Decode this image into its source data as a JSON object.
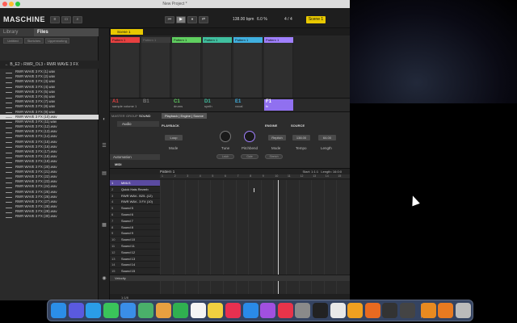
{
  "window": {
    "title": "New Project *"
  },
  "header": {
    "logo": "MASCHINE",
    "tempo": "138.00",
    "tempo_unit": "bpm",
    "cpu": "6.0 %",
    "time_sig": "4 / 4",
    "scene": "Scene 1"
  },
  "browser": {
    "tab_library": "Library",
    "tab_files": "Files",
    "subtabs": [
      "Untitled",
      "Sketches",
      "Upperworkng"
    ],
    "path": "← B_E2 › RWR_OL3 › RWR WAVE 3 FX",
    "files": [
      "RWR WAVE 3 FX (1).wav",
      "RWR WAVE 3 FX (2).wav",
      "RWR WAVE 3 FX (3).wav",
      "RWR WAVE 3 FX (4).wav",
      "RWR WAVE 3 FX (5).wav",
      "RWR WAVE 3 FX (6).wav",
      "RWR WAVE 3 FX (7).wav",
      "RWR WAVE 3 FX (8).wav",
      "RWR WAVE 3 FX (9).wav",
      "RWR WAVE 3 FX (10).wav",
      "RWR WAVE 3 FX (11).wav",
      "RWR WAVE 3 FX (12).wav",
      "RWR WAVE 3 FX (13).wav",
      "RWR WAVE 3 FX (14).wav",
      "RWR WAVE 3 FX (15).wav",
      "RWR WAVE 3 FX (16).wav",
      "RWR WAVE 3 FX (17).wav",
      "RWR WAVE 3 FX (18).wav",
      "RWR WAVE 3 FX (19).wav",
      "RWR WAVE 3 FX (20).wav",
      "RWR WAVE 3 FX (21).wav",
      "RWR WAVE 3 FX (22).wav",
      "RWR WAVE 3 FX (23).wav",
      "RWR WAVE 3 FX (24).wav",
      "RWR WAVE 3 FX (25).wav",
      "RWR WAVE 3 FX (26).wav",
      "RWR WAVE 3 FX (27).wav",
      "RWR WAVE 3 FX (28).wav",
      "RWR WAVE 3 FX (29).wav",
      "RWR WAVE 3 FX (30).wav"
    ],
    "selected_index": 9
  },
  "arranger": {
    "scene_label": "Scene 1",
    "patterns": [
      {
        "label": "Pattern 1",
        "color": "#e84040"
      },
      {
        "label": "Pattern 1",
        "color": "#3b3b3b"
      },
      {
        "label": "Pattern 1",
        "color": "#60d060"
      },
      {
        "label": "Pattern 1",
        "color": "#40c0a0"
      },
      {
        "label": "Pattern 1",
        "color": "#40b0e0"
      },
      {
        "label": "Pattern 1",
        "color": "#a080ff"
      }
    ]
  },
  "groups": [
    {
      "letter": "A1",
      "name": "sample volume 1",
      "color": "#e84040"
    },
    {
      "letter": "B1",
      "name": "",
      "color": "#777777"
    },
    {
      "letter": "C1",
      "name": "drums",
      "color": "#60d060"
    },
    {
      "letter": "D1",
      "name": "synth",
      "color": "#40c0a0"
    },
    {
      "letter": "E1",
      "name": "vocal",
      "color": "#40b0e0"
    },
    {
      "letter": "F1",
      "name": "fx",
      "color": "#a080ff"
    }
  ],
  "control": {
    "tabs": [
      "MASTER",
      "GROUP",
      "SOUND"
    ],
    "page_tab": "Playback | Engine | Source",
    "sound": "Audio",
    "sections": {
      "playback": "PLAYBACK",
      "engine": "ENGINE",
      "source": "SOURCE"
    },
    "mode_value": "Loop",
    "engine_value": "Repitch",
    "source_tempo": "138.00",
    "source_length": "64.00",
    "params": {
      "mode": "Mode",
      "tune": "Tune",
      "pitchbend": "Pitchbend",
      "engine": "Mode",
      "tempo": "Tempo",
      "length": "Length"
    },
    "buttons": [
      "Latch",
      "Gate",
      "Stretch"
    ],
    "automation": "Automation",
    "midi": "MIDI"
  },
  "pattern_editor": {
    "pattern_name": "Pattern 1",
    "start": "Start: 1:1:1",
    "length": "Length: 16:0:0",
    "pads": [
      {
        "num": "1",
        "name": "MMLS"
      },
      {
        "num": "2",
        "name": "Quick Hats Reverb"
      },
      {
        "num": "3",
        "name": "RWR WAV.. B25..(12)"
      },
      {
        "num": "4",
        "name": "RWR WAV.. 3 FX (10)"
      },
      {
        "num": "5",
        "name": "Sound 5"
      },
      {
        "num": "6",
        "name": "Sound 6"
      },
      {
        "num": "7",
        "name": "Sound 7"
      },
      {
        "num": "8",
        "name": "Sound 8"
      },
      {
        "num": "9",
        "name": "Sound 9"
      },
      {
        "num": "10",
        "name": "Sound 10"
      },
      {
        "num": "11",
        "name": "Sound 11"
      },
      {
        "num": "12",
        "name": "Sound 12"
      },
      {
        "num": "13",
        "name": "Sound 13"
      },
      {
        "num": "14",
        "name": "Sound 14"
      },
      {
        "num": "15",
        "name": "Sound 15"
      }
    ],
    "ruler": [
      "1",
      "2",
      "3",
      "4",
      "5",
      "6",
      "7",
      "8",
      "9",
      "10",
      "11",
      "12",
      "13",
      "14",
      "15"
    ],
    "velocity": "Velocity",
    "zoom": "1:1/8"
  },
  "dock": {
    "apps": [
      {
        "label": "Finder",
        "color": "#2b8ee8"
      },
      {
        "label": "Siri",
        "color": "#5a5adf"
      },
      {
        "label": "Safari",
        "color": "#2a9de8"
      },
      {
        "label": "Msg",
        "color": "#3ac45a"
      },
      {
        "label": "Mail",
        "color": "#3a8ee8"
      },
      {
        "label": "Maps",
        "color": "#4ab06a"
      },
      {
        "label": "Photos",
        "color": "#e8a040"
      },
      {
        "label": "FT",
        "color": "#30b050"
      },
      {
        "label": "Cal",
        "color": "#f4f4f4"
      },
      {
        "label": "Notes",
        "color": "#f0d040"
      },
      {
        "label": "News",
        "color": "#e83050"
      },
      {
        "label": "Store",
        "color": "#2a8ae8"
      },
      {
        "label": "Pod",
        "color": "#a050e0"
      },
      {
        "label": "Music",
        "color": "#e8344a"
      },
      {
        "label": "Set",
        "color": "#8a8a8a"
      },
      {
        "label": "TV",
        "color": "#222222"
      },
      {
        "label": "Chr",
        "color": "#e8e8e8"
      },
      {
        "label": "Audio",
        "color": "#f0a020"
      },
      {
        "label": "Live",
        "color": "#e86a20"
      },
      {
        "label": "MA",
        "color": "#333333"
      },
      {
        "label": "iSt",
        "color": "#444444"
      },
      {
        "label": "Aud",
        "color": "#e88a20"
      },
      {
        "label": "Aud2",
        "color": "#e87a20"
      },
      {
        "label": "Trash",
        "color": "#bbbbbb"
      }
    ]
  }
}
